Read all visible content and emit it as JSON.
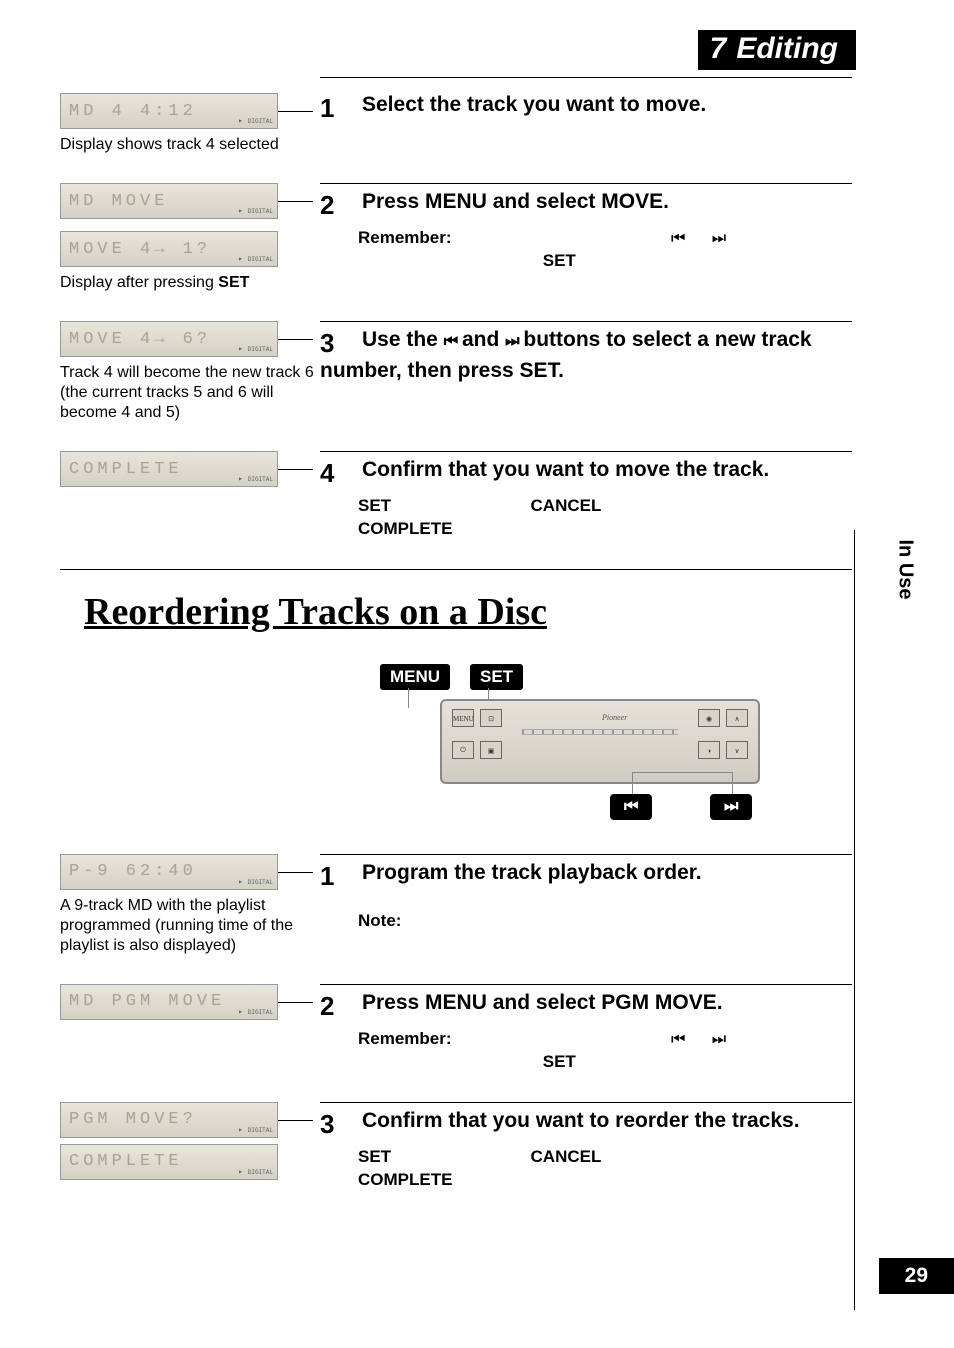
{
  "chapter": {
    "num": "7",
    "title": "Editing"
  },
  "side_label": "In Use",
  "page_number": "29",
  "move_section": {
    "steps": [
      {
        "num": "1",
        "lcds": [
          {
            "text": "MD    4    4:12",
            "badge": "DIGITAL"
          }
        ],
        "caption": "Display shows track 4 selected",
        "title": "Select the track you want to move.",
        "body": ""
      },
      {
        "num": "2",
        "lcds": [
          {
            "text": "MD    MOVE",
            "badge": "DIGITAL"
          },
          {
            "text": "MOVE   4→   1?",
            "badge": "DIGITAL"
          }
        ],
        "caption_html": "Display after pressing <b>SET</b>",
        "title": "Press MENU and select MOVE.",
        "remember_label": "Remember:",
        "set_label": "SET",
        "prev_icon": "⏮",
        "next_icon": "⏭"
      },
      {
        "num": "3",
        "lcds": [
          {
            "text": "MOVE   4→   6?",
            "badge": "DIGITAL"
          }
        ],
        "caption": "Track 4 will become the new track 6 (the current tracks 5 and 6 will become 4 and 5)",
        "title_before": "Use the ",
        "title_mid": " and ",
        "title_after": " buttons to select a new track number, then press SET.",
        "prev_icon": "⏮",
        "next_icon": "⏭"
      },
      {
        "num": "4",
        "lcds": [
          {
            "text": "COMPLETE",
            "badge": "DIGITAL"
          }
        ],
        "caption": "",
        "title": "Confirm that you want to move the track.",
        "set_label": "SET",
        "cancel_label": "CANCEL",
        "complete_label": "COMPLETE"
      }
    ]
  },
  "reorder_section": {
    "title": "Reordering Tracks on a Disc",
    "remote": {
      "menu_label": "MENU",
      "set_label": "SET",
      "prev_label": "⏮",
      "next_label": "⏭",
      "brand": "Pioneer",
      "btn_menu": "MENU",
      "btn_power": "⏻",
      "btn_up": "∧",
      "btn_down": "∨"
    },
    "steps": [
      {
        "num": "1",
        "lcds": [
          {
            "text": "P-9      62:40",
            "badge": "DIGITAL"
          }
        ],
        "caption": "A 9-track MD with the playlist programmed (running time of the playlist is also displayed)",
        "title": "Program the track playback order.",
        "note_label": "Note:"
      },
      {
        "num": "2",
        "lcds": [
          {
            "text": "MD  PGM MOVE",
            "badge": "DIGITAL"
          }
        ],
        "caption": "",
        "title": "Press MENU and select PGM MOVE.",
        "remember_label": "Remember:",
        "set_label": "SET",
        "prev_icon": "⏮",
        "next_icon": "⏭"
      },
      {
        "num": "3",
        "lcds": [
          {
            "text": "PGM MOVE?",
            "badge": "DIGITAL"
          },
          {
            "text": "COMPLETE",
            "badge": "DIGITAL"
          }
        ],
        "caption": "",
        "title": "Confirm that you want to reorder the tracks.",
        "set_label": "SET",
        "cancel_label": "CANCEL",
        "complete_label": "COMPLETE"
      }
    ]
  }
}
